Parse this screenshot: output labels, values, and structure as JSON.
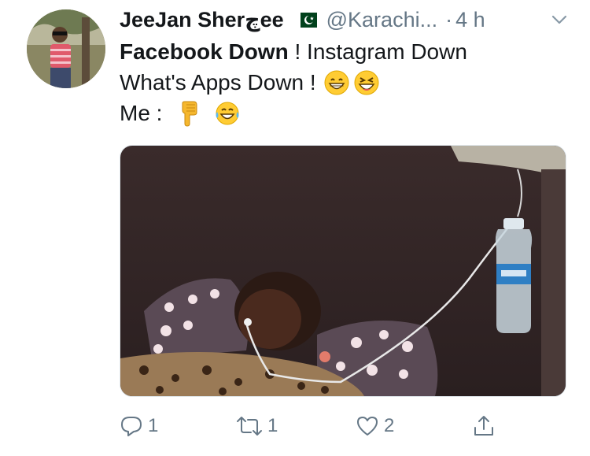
{
  "tweet": {
    "author_name": "JeeJan Sherچee",
    "author_handle": "@Karachi...",
    "time_sep": "·",
    "time": "4 h",
    "line1_bold": "Facebook Down",
    "line1_rest": " ! Instagram Down",
    "line2": "What's Apps Down !",
    "line3": "Me :"
  },
  "icons": {
    "avatar": "avatar-photo",
    "flag": "pakistan-flag-icon",
    "menu": "chevron-down-icon",
    "emoji1": "grinning-face-emoji",
    "emoji2": "laughing-squinting-emoji",
    "emoji3": "pointing-down-emoji",
    "emoji4": "tears-of-joy-emoji"
  },
  "actions": {
    "reply_count": "1",
    "retweet_count": "1",
    "like_count": "2"
  },
  "colors": {
    "text": "#14171a",
    "secondary": "#657786",
    "border": "#e1e8ed"
  }
}
